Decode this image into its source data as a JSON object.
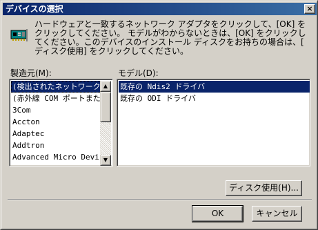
{
  "window": {
    "title": "デバイスの選択",
    "close_glyph": "×"
  },
  "instruction": "ハードウェアと一致するネットワーク アダプタをクリックして、[OK] を\nクリックしてください。 モデルがわからないときは、[OK] をクリックし\nてください。このデバイスのインストール ディスクをお持ちの場合は、[\nディスク使用] をクリックしてください。",
  "manufacturers": {
    "label": "製造元(M):",
    "items": [
      "(検出されたネットワーク",
      "(赤外線 COM ポートまた",
      "3Com",
      "Accton",
      "Adaptec",
      "Addtron",
      "Advanced Micro Device"
    ],
    "selected_index": 0
  },
  "models": {
    "label": "モデル(D):",
    "items": [
      "既存の Ndis2 ドライバ",
      "既存の ODI ドライバ"
    ],
    "selected_index": 0
  },
  "buttons": {
    "have_disk": "ディスク使用(H)...",
    "ok": "OK",
    "cancel": "キャンセル"
  },
  "scroll_arrows": {
    "up": "▲",
    "down": "▼"
  },
  "colors": {
    "title_bar": "#0a246a",
    "selection": "#0a246a",
    "face": "#d4d0c8"
  }
}
